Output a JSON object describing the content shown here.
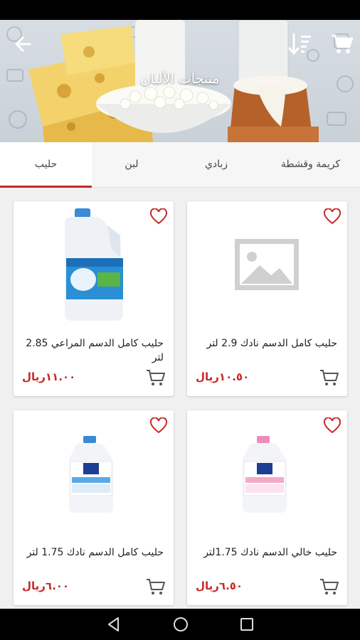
{
  "header": {
    "title": "منتجات الألبان",
    "back_icon": "arrow-back-icon",
    "sort_icon": "sort-icon",
    "cart_icon": "cart-icon"
  },
  "tabs": [
    {
      "label": "حليب",
      "active": true
    },
    {
      "label": "لبن",
      "active": false
    },
    {
      "label": "زبادي",
      "active": false
    },
    {
      "label": "كريمة وقشطة",
      "active": false
    }
  ],
  "products": [
    {
      "name": "حليب كامل الدسم نادك 2.9 لتر",
      "price": "١٠.٥٠ريال",
      "image": "placeholder-image"
    },
    {
      "name": "حليب كامل الدسم المراعي 2.85 لتر",
      "price": "١١.٠٠ريال",
      "image": "milk-gallon-green"
    },
    {
      "name": "حليب خالي الدسم نادك 1.75لتر",
      "price": "٦.٥٠ريال",
      "image": "milk-bottle-pink"
    },
    {
      "name": "حليب كامل الدسم نادك 1.75 لتر",
      "price": "٦.٠٠ريال",
      "image": "milk-bottle-blue"
    }
  ],
  "colors": {
    "accent": "#c62828",
    "tab_bg": "#f6f6f6",
    "background": "#f0f0f0"
  }
}
